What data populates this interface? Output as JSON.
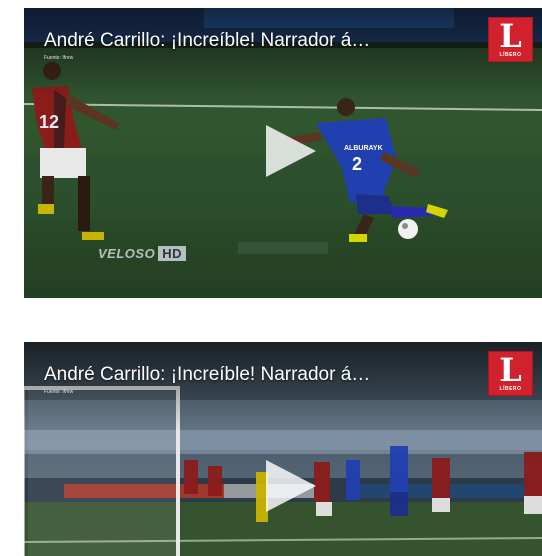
{
  "videos": [
    {
      "title": "André Carrillo: ¡Increíble! Narrador á…",
      "source": "Fuente: Ifrew",
      "logo": {
        "letter": "L",
        "word": "LÍBERO",
        "color": "#d1212c"
      },
      "player_shirt": "ALBURAYK",
      "player_number": "2",
      "broadcaster": "VELOSO",
      "broadcaster_box": "HD"
    },
    {
      "title": "André Carrillo: ¡Increíble! Narrador á…",
      "source": "Fuente: Ifrew",
      "logo": {
        "letter": "L",
        "word": "LÍBERO",
        "color": "#d1212c"
      }
    }
  ]
}
